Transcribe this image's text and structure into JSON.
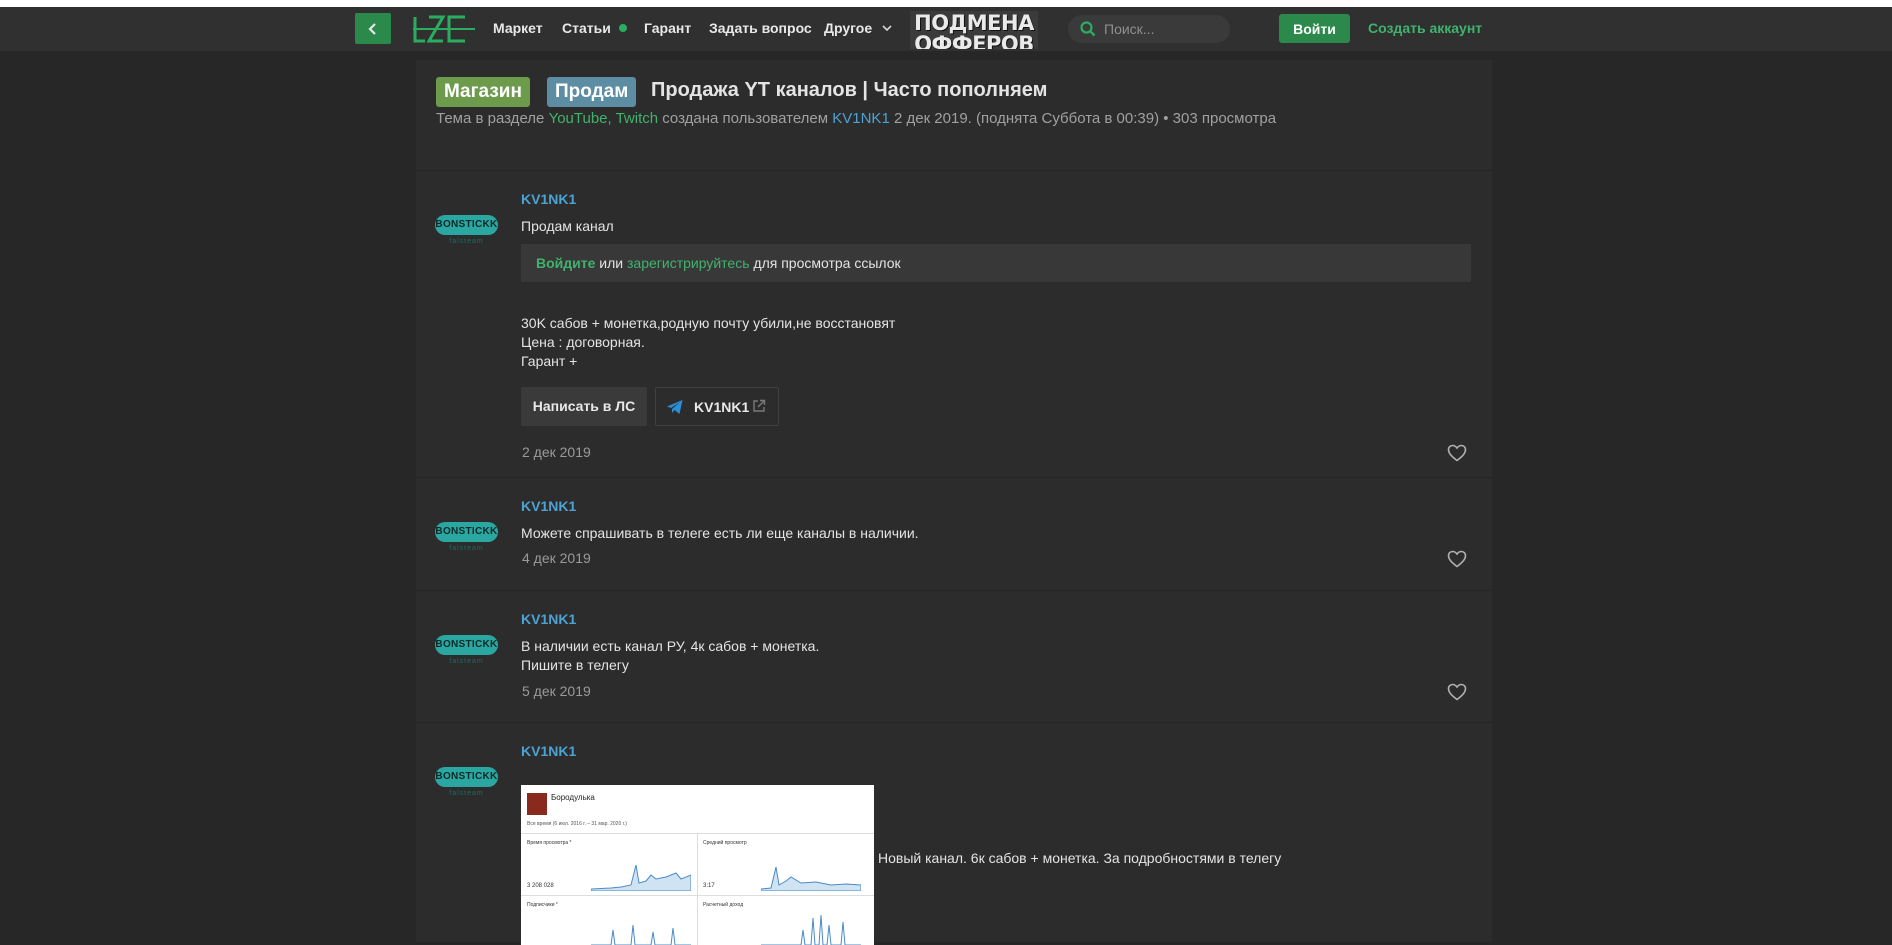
{
  "nav": {
    "items": [
      "Маркет",
      "Статьи",
      "Гарант",
      "Задать вопрос",
      "Другое"
    ],
    "banner_lines": [
      "ПОДМЕНА",
      "ОФФЕРОВ"
    ],
    "search_placeholder": "Поиск...",
    "login_label": "Войти",
    "register_label": "Создать аккаунт"
  },
  "thread": {
    "prefix_tags": [
      "Магазин",
      "Продам"
    ],
    "title": "Продажа YT каналов | Часто пополняем",
    "meta": {
      "prefix": "Тема в разделе",
      "section": "YouTube, Twitch",
      "created_by": "создана пользователем",
      "author": "KV1NK1",
      "date_info": "2 дек 2019. (поднята Суббота в 00:39)",
      "views": "• 303 просмотра"
    }
  },
  "posts": [
    {
      "author": "KV1NK1",
      "avatar": {
        "badge": "BONSTICKK",
        "sub": "falsteam"
      },
      "lines_top": [
        "Продам канал"
      ],
      "notice": {
        "login": "Войдите",
        "or": "или",
        "register": "зарегистрируйтесь",
        "rest": "для просмотра ссылок"
      },
      "lines": [
        "30K сабов + монетка,родную почту убили,не восстановят",
        "Цена : договорная.",
        "Гарант +"
      ],
      "pm_button": "Написать в ЛС",
      "telegram": "KV1NK1",
      "date": "2 дек 2019"
    },
    {
      "author": "KV1NK1",
      "lines": [
        "Можете спрашивать в телеге есть ли еще каналы в наличии."
      ],
      "date": "4 дек 2019"
    },
    {
      "author": "KV1NK1",
      "lines": [
        "В наличии есть канал РУ, 4к сабов + монетка.",
        "Пишите в телегу"
      ],
      "date": "5 дек 2019"
    },
    {
      "author": "KV1NK1",
      "caption": "Новый канал. 6к сабов + монетка. За подробностями в телегу",
      "screenshot": {
        "channel": "Бородулька",
        "range": "Все время (6 июл. 2016 г. – 31 мар. 2020 г.)",
        "card1_label": "Время просмотра *",
        "card1_value": "3 208 028",
        "card2_label": "Средний просмотр",
        "card2_value": "3:17",
        "card3_label": "Подписчики *",
        "card4_label": "Расчетный доход"
      }
    }
  ],
  "colors": {
    "accent_green": "#2b8a4b",
    "link_green": "#3fb36c",
    "link_blue": "#4ba3d4",
    "tag_shop": "#6c9b4c",
    "tag_sell": "#5c8da3"
  }
}
